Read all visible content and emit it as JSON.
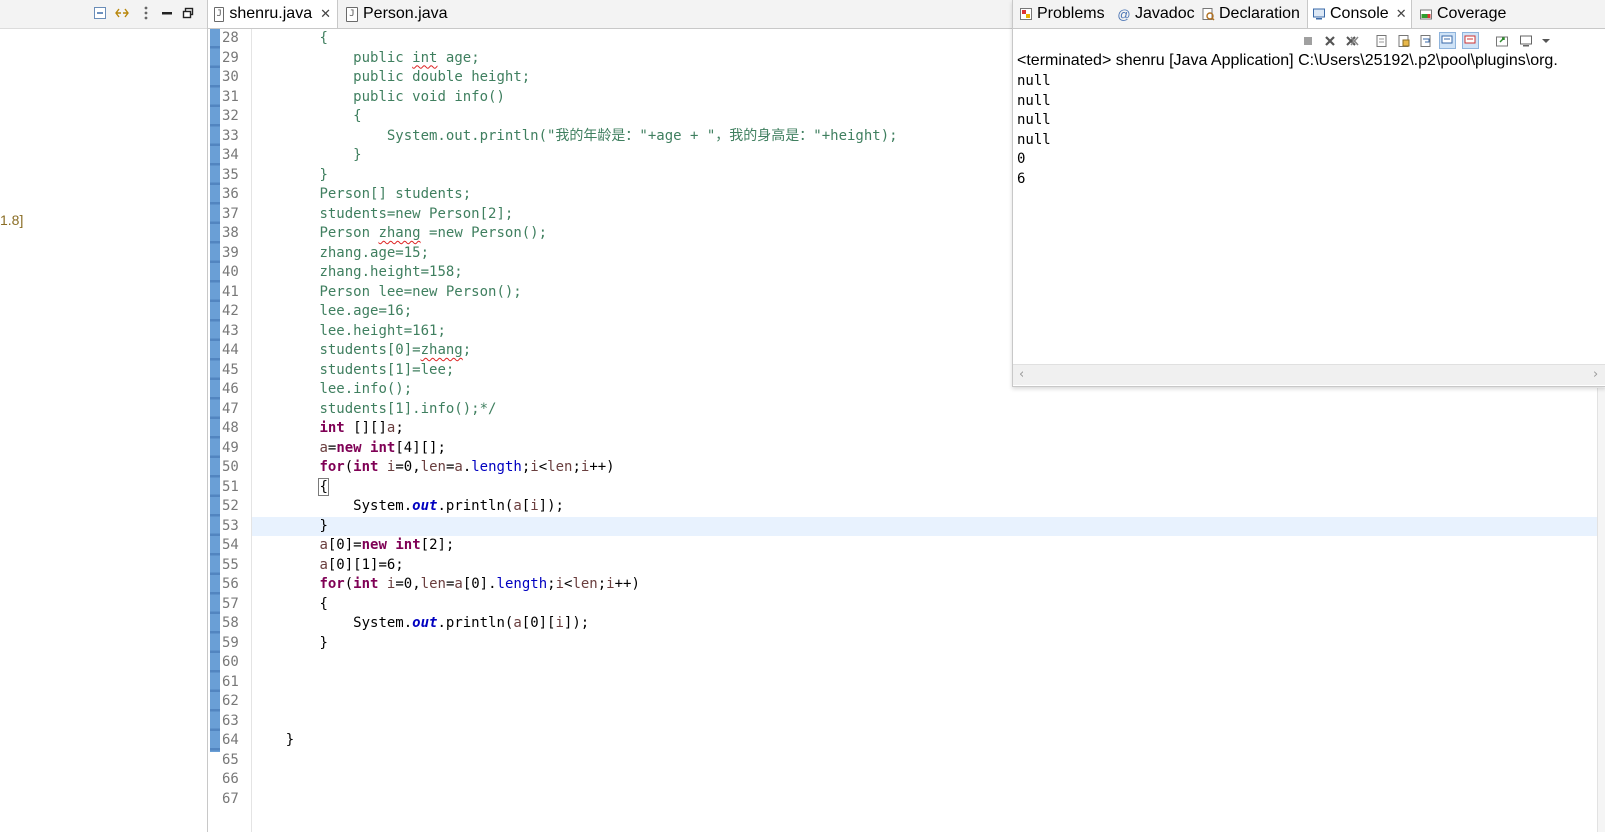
{
  "left_panel": {
    "tree_fragment": "1.8]"
  },
  "editor": {
    "tabs": [
      {
        "label": "shenru.java",
        "active": true,
        "closable": true
      },
      {
        "label": "Person.java",
        "active": false,
        "closable": false
      }
    ],
    "line_numbers": [
      "28",
      "29",
      "30",
      "31",
      "32",
      "33",
      "34",
      "35",
      "36",
      "37",
      "38",
      "39",
      "40",
      "41",
      "42",
      "43",
      "44",
      "45",
      "46",
      "47",
      "48",
      "49",
      "50",
      "51",
      "52",
      "53",
      "54",
      "55",
      "56",
      "57",
      "58",
      "59",
      "60",
      "61",
      "62",
      "63",
      "64",
      "65",
      "66",
      "67"
    ],
    "current_line": "53"
  },
  "code_tokens": {
    "kw_public": "public",
    "kw_int": "int",
    "kw_double": "double",
    "kw_void": "void",
    "kw_new": "new",
    "kw_for": "for",
    "fld_age": "age",
    "fld_height": "height",
    "fld_length": "length",
    "fld_out": "out",
    "var_a": "a",
    "var_i": "i",
    "var_len": "len",
    "id_zhang": "zhang",
    "method_info": "info()",
    "println_str": "System.out.println(\"我的年龄是：\"+age + \"，我的身高是：\"+height);",
    "arr_students_decl": "Person[] students;",
    "line37": "students=new Person[2];",
    "line38_prefix": "Person ",
    "line38_suffix": " =new Person();",
    "line39": "zhang.age=15;",
    "line40": "zhang.height=158;",
    "line41": "Person lee=new Person();",
    "line42": "lee.age=16;",
    "line43": "lee.height=161;",
    "line44_prefix": "students[0]=",
    "line44_suffix": ";",
    "line45": "students[1]=lee;",
    "line46": "lee.info();",
    "line47": "students[1].info();*/",
    "open_brace": "{",
    "close_brace": "}",
    "system_dot": "System.",
    "println_open": ".println(",
    "idx_i": "[",
    "idx_close": "]);",
    "arr_decl": " [][]",
    "semi": ";",
    "eq": "=",
    "new_int4": "[4][];",
    "for_open": "(",
    "for_mid1": " ",
    "for_eq0": "=0,",
    "for_lt": "<",
    "for_inc": "++)",
    "dot": ".",
    "a0": "[0]",
    "a01": "[0][1]=6;",
    "new_int2": "[2];",
    "a0i": "[0][",
    "space": " "
  },
  "console": {
    "tabs": [
      {
        "label": "Problems",
        "icon": "problems-icon",
        "active": false
      },
      {
        "label": "Javadoc",
        "icon": "javadoc-icon",
        "active": false
      },
      {
        "label": "Declaration",
        "icon": "declaration-icon",
        "active": false
      },
      {
        "label": "Console",
        "icon": "console-icon",
        "active": true,
        "closable": true
      },
      {
        "label": "Coverage",
        "icon": "coverage-icon",
        "active": false
      }
    ],
    "header": "<terminated> shenru [Java Application] C:\\Users\\25192\\.p2\\pool\\plugins\\org.",
    "output": [
      "null",
      "null",
      "null",
      "null",
      "0",
      "6"
    ]
  }
}
